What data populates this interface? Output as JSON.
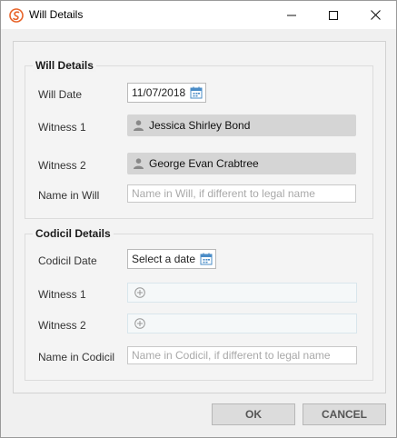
{
  "window": {
    "title": "Will Details",
    "icon": "swirl-logo-icon",
    "accent_color": "#e8642a"
  },
  "will_details": {
    "legend": "Will Details",
    "will_date_label": "Will Date",
    "will_date_value": "11/07/2018",
    "witness1_label": "Witness 1",
    "witness1_value": "Jessica Shirley Bond",
    "witness2_label": "Witness 2",
    "witness2_value": "George Evan Crabtree",
    "name_label": "Name in Will",
    "name_placeholder": "Name in Will, if different to legal name"
  },
  "codicil_details": {
    "legend": "Codicil Details",
    "date_label": "Codicil Date",
    "date_value": "Select a date",
    "witness1_label": "Witness 1",
    "witness2_label": "Witness 2",
    "name_label": "Name in Codicil",
    "name_placeholder": "Name in Codicil, if different to legal name"
  },
  "footer": {
    "ok_label": "OK",
    "cancel_label": "CANCEL"
  }
}
